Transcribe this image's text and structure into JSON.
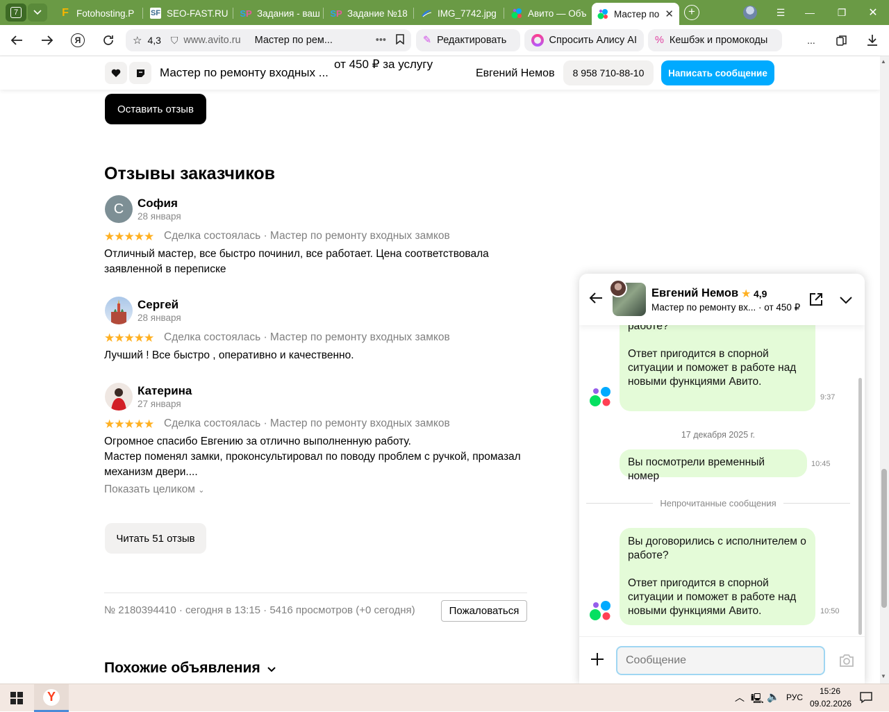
{
  "browser": {
    "tab_count": "7",
    "tabs": [
      {
        "label": "Fotohosting.P",
        "icon": "fotohosting-favicon"
      },
      {
        "label": "SEO-FAST.RU",
        "icon": "seofast-favicon"
      },
      {
        "label": "Задания - ваш",
        "icon": "sp-favicon"
      },
      {
        "label": "Задание №18",
        "icon": "sp-favicon"
      },
      {
        "label": "IMG_7742.jpg",
        "icon": "image-favicon"
      },
      {
        "label": "Авито — Объ",
        "icon": "avito-favicon"
      },
      {
        "label": "Мастер по",
        "icon": "avito-favicon",
        "active": true
      }
    ],
    "rating": "4,3",
    "url": "www.avito.ru",
    "page_title": "Мастер по рем...",
    "edit_label": "Редактировать",
    "alice_label": "Спросить Алису AI",
    "cashback_label": "Кешбэк и промокоды",
    "more_label": "..."
  },
  "sticky": {
    "title": "Мастер по ремонту входных ...",
    "price": "от 450 ₽ за услугу",
    "seller": "Евгений Немов",
    "phone": "8 958 710-88-10",
    "write_label": "Написать сообщение"
  },
  "page": {
    "leave_review": "Оставить отзыв",
    "reviews_title": "Отзывы заказчиков",
    "reviews": [
      {
        "initial": "С",
        "name": "София",
        "date": "28 января",
        "stars": 5,
        "meta": "Сделка состоялась · Мастер по ремонту входных замков",
        "text": "Отличный мастер, все быстро починил, все работает. Цена соответствовала заявленной в переписке"
      },
      {
        "initial": "",
        "name": "Сергей",
        "date": "28 января",
        "stars": 5,
        "meta": "Сделка состоялась · Мастер по ремонту входных замков",
        "text": "Лучший ! Все быстро , оперативно и качественно."
      },
      {
        "initial": "",
        "name": "Катерина",
        "date": "27 января",
        "stars": 5,
        "meta": "Сделка состоялась · Мастер по ремонту входных замков",
        "text1": "Огромное спасибо Евгению за отлично выполненную работу.",
        "text2": "Мастер поменял замки, проконсультировал по поводу проблем с ручкой, промазал механизм двери...."
      }
    ],
    "show_full": "Показать целиком",
    "read_all": "Читать 51 отзыв",
    "footer_info": "№ 2180394410 · сегодня в 13:15 · 5416 просмотров (+0 сегодня)",
    "report_label": "Пожаловаться",
    "similar_title": "Похожие объявления"
  },
  "chat": {
    "name": "Евгений Немов",
    "rating": "4,9",
    "subtitle": "Мастер по ремонту вх...",
    "price": "· от 450 ₽",
    "msg1_partial": "Вы договорились с исполнителем о работе?",
    "msg1_part2": "Ответ пригодится в спорной ситуации и поможет в работе над новыми функциями Авито.",
    "msg1_time": "9:37",
    "date_sep": "17 декабря 2025 г.",
    "msg2": "Вы посмотрели временный номер",
    "msg2_time": "10:45",
    "unread_label": "Непрочитанные сообщения",
    "msg3_part1": "Вы договорились с исполнителем о работе?",
    "msg3_part2": "Ответ пригодится в спорной ситуации и поможет в работе над новыми функциями Авито.",
    "msg3_time": "10:50",
    "input_placeholder": "Сообщение"
  },
  "taskbar": {
    "lang": "РУС",
    "time": "15:26",
    "date": "09.02.2026"
  },
  "colors": {
    "tabstrip": "#6a9a45",
    "accent_blue": "#00aaff",
    "star": "#ffb021",
    "bubble": "#e4fbd8"
  }
}
